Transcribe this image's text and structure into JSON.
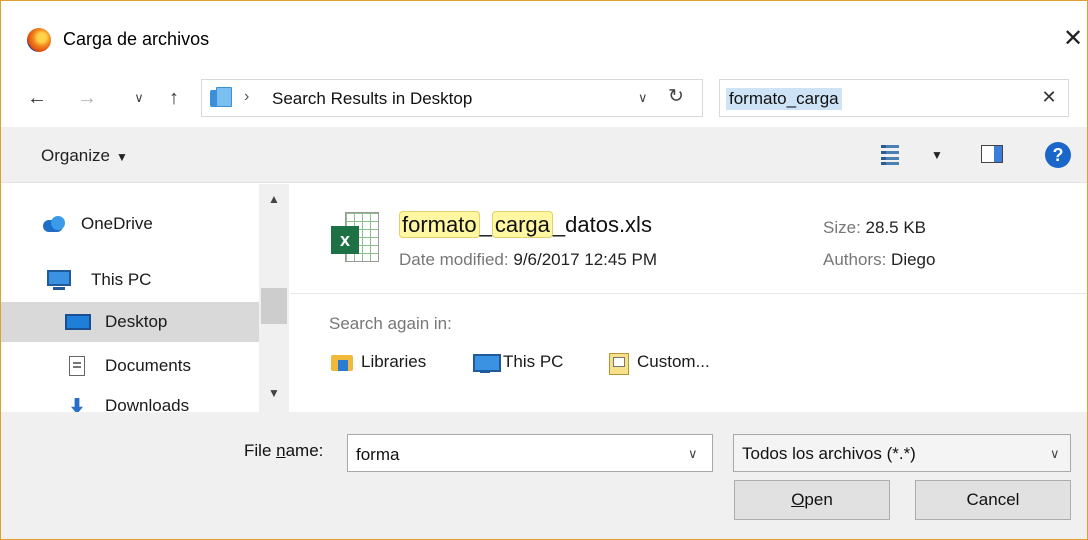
{
  "window": {
    "title": "Carga de archivos"
  },
  "address_bar": {
    "path": "Search Results in Desktop"
  },
  "search": {
    "value": "formato_carga"
  },
  "toolbar": {
    "organize_label": "Organize"
  },
  "navigation": {
    "items": [
      {
        "label": "OneDrive",
        "icon": "onedrive-icon",
        "selected": false
      },
      {
        "label": "This PC",
        "icon": "computer-icon",
        "selected": false
      },
      {
        "label": "Desktop",
        "icon": "desktop-icon",
        "selected": true
      },
      {
        "label": "Documents",
        "icon": "documents-icon",
        "selected": false
      },
      {
        "label": "Downloads",
        "icon": "downloads-icon",
        "selected": false
      }
    ]
  },
  "results": {
    "file": {
      "name_parts": [
        "formato",
        "_",
        "carga",
        "_datos.xls"
      ],
      "date_label": "Date modified:",
      "date_value": "9/6/2017 12:45 PM",
      "size_label": "Size:",
      "size_value": "28.5 KB",
      "authors_label": "Authors:",
      "authors_value": "Diego"
    },
    "search_again_label": "Search again in:",
    "search_again_locations": [
      {
        "label": "Libraries",
        "icon": "libraries-icon"
      },
      {
        "label": "This PC",
        "icon": "computer-icon"
      },
      {
        "label": "Custom...",
        "icon": "custom-folder-icon"
      }
    ]
  },
  "footer": {
    "file_name_label_prefix": "File ",
    "file_name_label_access": "n",
    "file_name_label_suffix": "ame:",
    "file_name_value": "forma",
    "filter_value": "Todos los archivos (*.*)",
    "open_access": "O",
    "open_rest": "pen",
    "cancel_label": "Cancel"
  }
}
